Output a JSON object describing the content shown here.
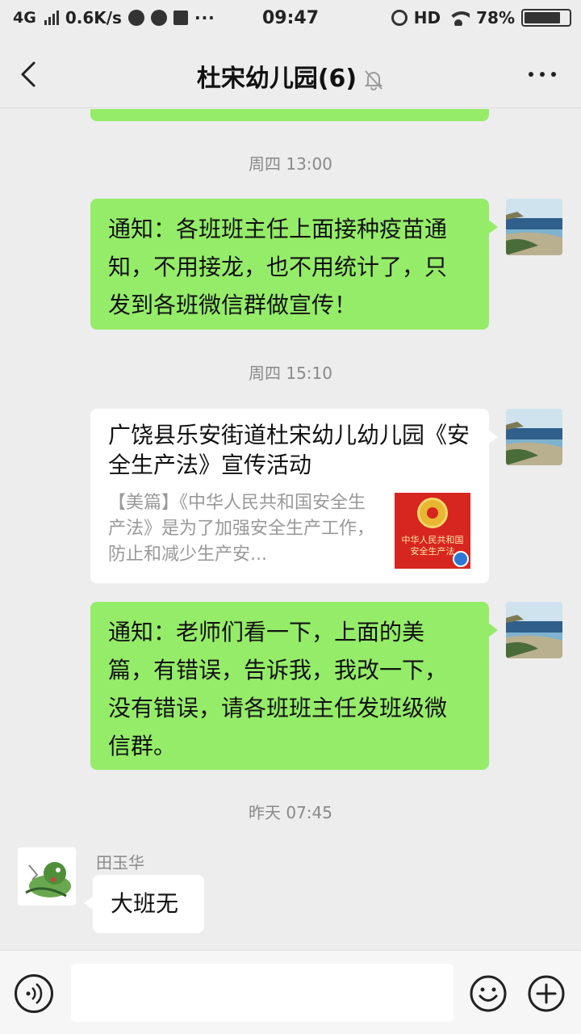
{
  "status_bar": {
    "network": "4G",
    "speed": "0.6K/s",
    "extra": "···",
    "time": "09:47",
    "hd": "HD",
    "battery": "78%"
  },
  "header": {
    "title": "杜宋幼儿园(6)"
  },
  "messages": [
    {
      "timestamp": "周四 13:00",
      "text_lines": [
        "通知：各班班主任上面接种疫苗通",
        "知，不用接龙，也不用统计了，只",
        "发到各班微信群做宣传！"
      ]
    },
    {
      "timestamp": "周四 15:10"
    },
    {
      "card": {
        "title": "广饶县乐安街道杜宋幼儿幼儿园《安全生产法》宣传活动",
        "description": "【美篇】《中华人民共和国安全生产法》是为了加强安全生产工作，防止和减少生产安...",
        "thumb_text": "中华人民共和国\n安全生产法"
      }
    },
    {
      "text_lines": [
        "通知：老师们看一下，上面的美",
        "篇，有错误，告诉我，我改一下，",
        "没有错误，请各班班主任发班级微",
        "信群。"
      ]
    },
    {
      "timestamp": "昨天 07:45"
    },
    {
      "sender": "田玉华",
      "text": "大班无"
    }
  ],
  "colors": {
    "outgoing_bubble": "#95ec69",
    "incoming_bubble": "#ffffff",
    "background": "#ededed"
  },
  "icons": [
    "back-icon",
    "mute-icon",
    "more-icon",
    "voice-icon",
    "emoji-icon",
    "plus-icon"
  ]
}
